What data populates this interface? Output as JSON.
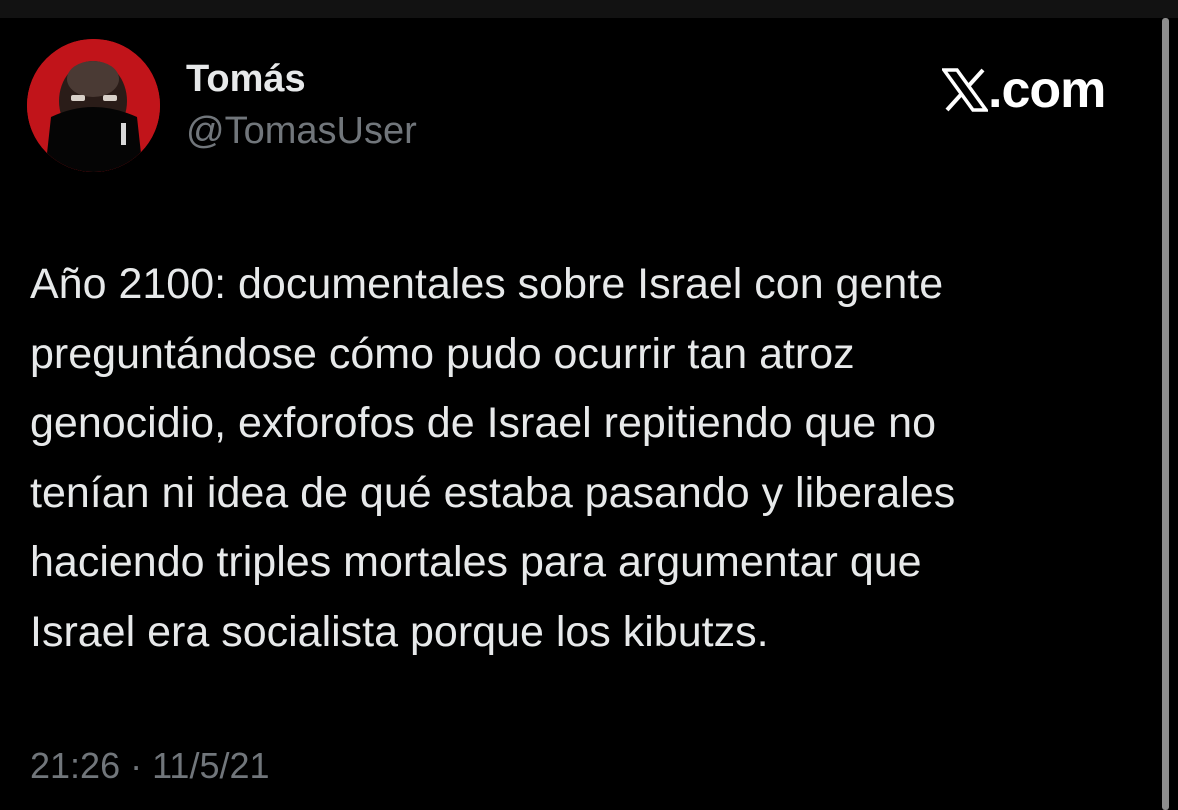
{
  "user": {
    "display_name": "Tomás",
    "handle": "@TomasUser",
    "avatar_icon": "profile-photo"
  },
  "brand": {
    "logo_icon": "x-logo-icon",
    "text": ".com"
  },
  "tweet": {
    "text": "Año 2100: documentales sobre Israel con gente\npreguntándose cómo pudo ocurrir tan atroz\ngenocidio, exforofos de Israel repitiendo que no\ntenían ni idea de qué estaba pasando y liberales\nhaciendo triples mortales para argumentar que\nIsrael era socialista porque los kibutzs.",
    "timestamp": "21:26 · 11/5/21"
  },
  "colors": {
    "background": "#000000",
    "primary_text": "#e7e9ea",
    "secondary_text": "#71767b",
    "avatar_background": "#c1141a"
  }
}
